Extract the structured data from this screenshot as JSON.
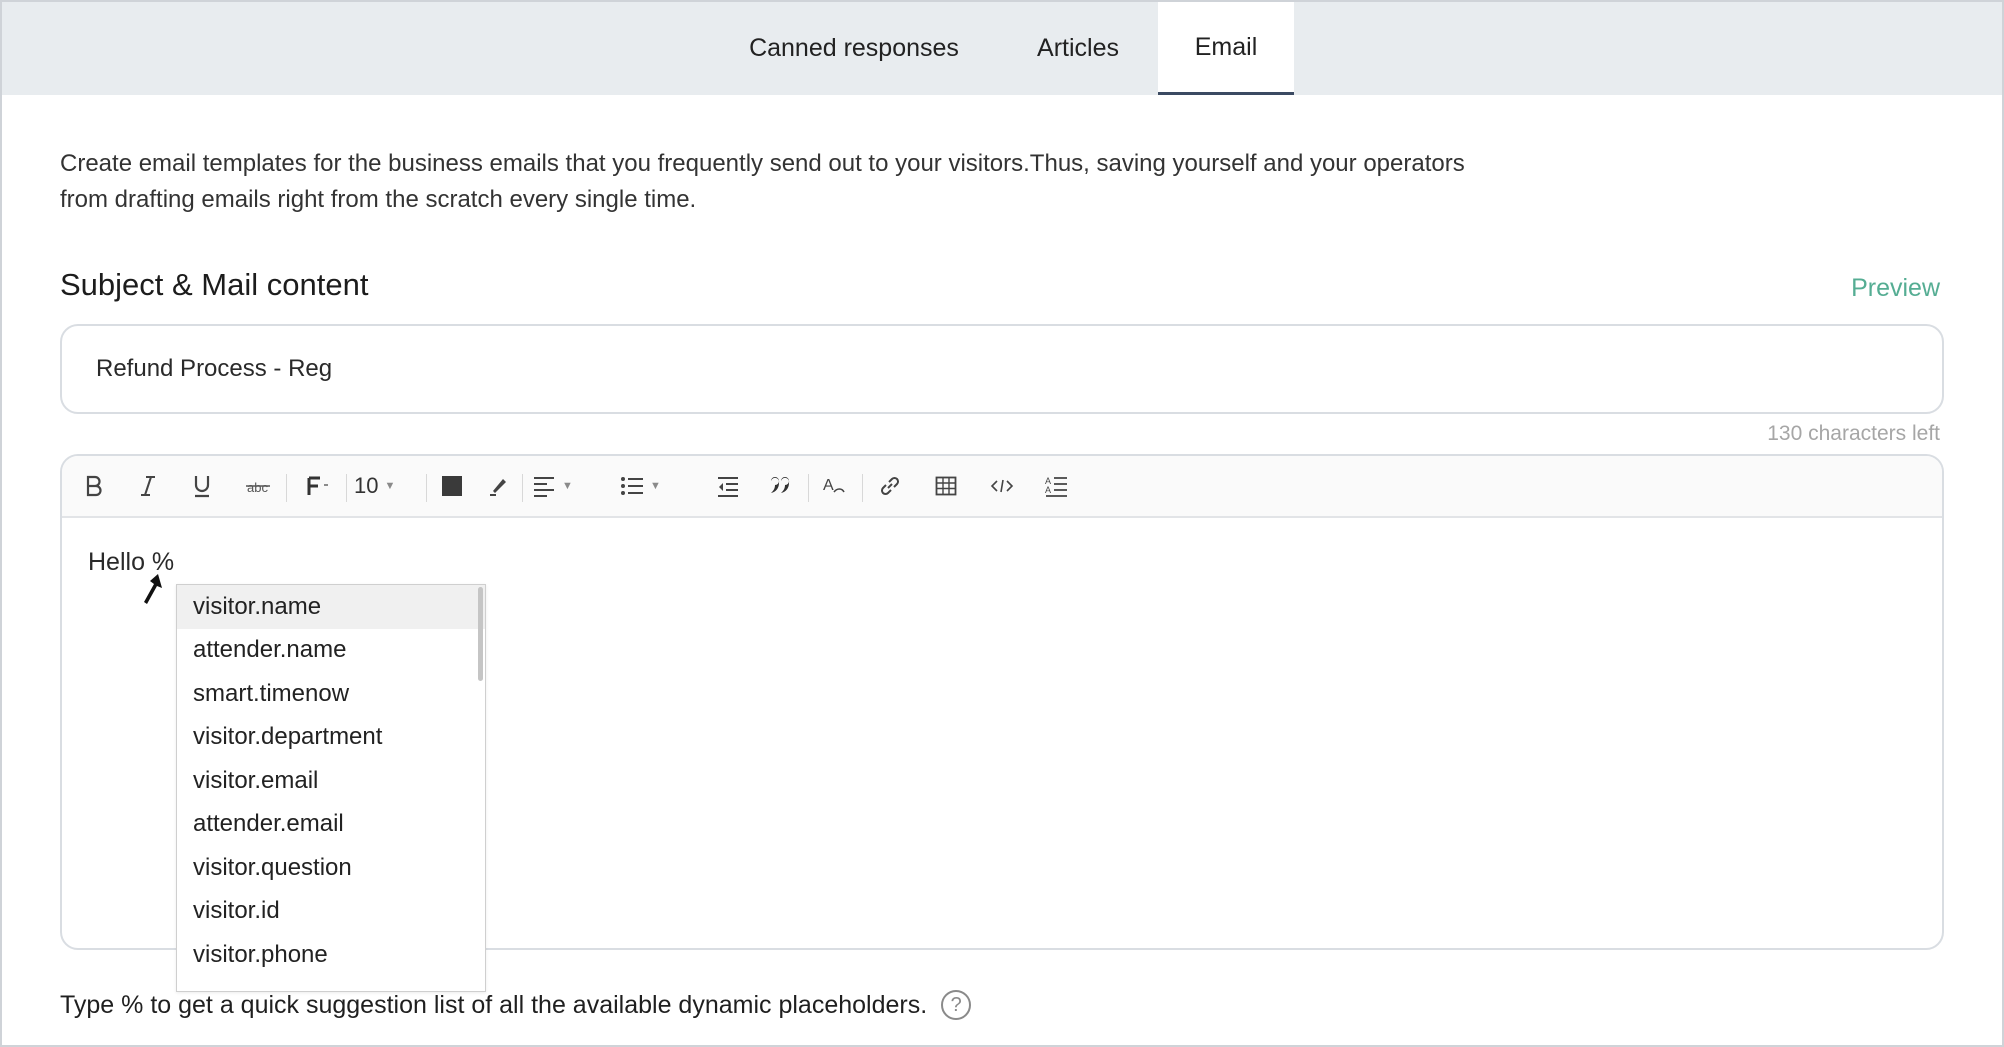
{
  "tabs": [
    {
      "label": "Canned responses"
    },
    {
      "label": "Articles"
    },
    {
      "label": "Email"
    }
  ],
  "intro": {
    "line1": "Create email templates for the business emails that you frequently send out to your visitors.Thus, saving yourself and your operators",
    "line2": "from drafting emails right from the scratch every single time."
  },
  "section": {
    "title": "Subject & Mail content",
    "preview_label": "Preview"
  },
  "subject": {
    "value": "Refund Process - Reg",
    "chars_left": "130 characters left"
  },
  "toolbar": {
    "font_size": "10",
    "icons": [
      "bold-icon",
      "italic-icon",
      "underline-icon",
      "strikethrough-icon",
      "font-family-icon",
      "font-color-icon",
      "highlight-icon",
      "align-icon",
      "list-icon",
      "outdent-icon",
      "quote-icon",
      "clear-format-icon",
      "link-icon",
      "table-icon",
      "code-icon",
      "line-height-icon"
    ]
  },
  "editor": {
    "content": "Hello %"
  },
  "suggestions": [
    "visitor.name",
    "attender.name",
    "smart.timenow",
    "visitor.department",
    "visitor.email",
    "attender.email",
    "visitor.question",
    "visitor.id",
    "visitor.phone"
  ],
  "hint": {
    "text": "Type % to get a quick suggestion list of all the available dynamic placeholders.",
    "help_symbol": "?"
  }
}
